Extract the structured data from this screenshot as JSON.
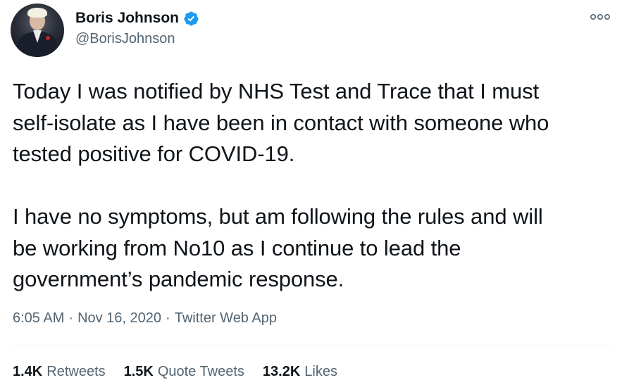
{
  "author": {
    "display_name": "Boris Johnson",
    "handle": "@BorisJohnson",
    "verified_icon": "verified-badge-icon",
    "avatar": "profile-avatar"
  },
  "tweet": {
    "paragraph_1": "Today I was notified by NHS Test and Trace that I must\nself-isolate as I have been in contact with someone who\ntested positive for COVID-19.",
    "paragraph_2": "I have no symptoms, but am following the rules and will\nbe working from No10 as I continue to lead the\ngovernment’s pandemic response."
  },
  "meta": {
    "time": "6:05 AM",
    "date": "Nov 16, 2020",
    "separator": "·",
    "source": "Twitter Web App"
  },
  "stats": {
    "retweets_count": "1.4K",
    "retweets_label": "Retweets",
    "quote_count": "1.5K",
    "quote_label": "Quote Tweets",
    "likes_count": "13.2K",
    "likes_label": "Likes"
  },
  "icons": {
    "more": "more-options-icon"
  },
  "colors": {
    "text_primary": "#0f1419",
    "text_secondary": "#536471",
    "verified_blue": "#1d9bf0",
    "divider": "#eff3f4"
  }
}
